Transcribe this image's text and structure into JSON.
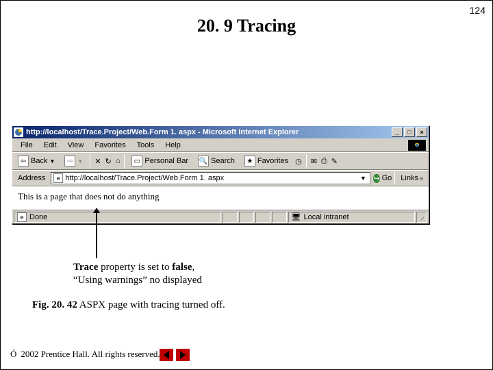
{
  "page_number": "124",
  "heading": "20. 9  Tracing",
  "browser": {
    "title": "http://localhost/Trace.Project/Web.Form 1. aspx - Microsoft Internet Explorer",
    "menus": {
      "file": "File",
      "edit": "Edit",
      "view": "View",
      "favorites": "Favorites",
      "tools": "Tools",
      "help": "Help"
    },
    "toolbar": {
      "back": "Back",
      "personal_bar": "Personal Bar",
      "search": "Search",
      "favorites": "Favorites"
    },
    "address_label": "Address",
    "url": "http://localhost/Trace.Project/Web.Form 1. aspx",
    "go": "Go",
    "links": "Links",
    "page_text": "This is a page that does not do anything",
    "status_done": "Done",
    "zone": "Local intranet"
  },
  "annotation": {
    "line1_prefix_bold": "Trace",
    "line1_rest": " property is set to ",
    "line1_bold2": "false",
    "line1_tail": ",",
    "line2": "“Using warnings” no displayed"
  },
  "figure": {
    "label_bold": "Fig. 20. 42",
    "caption": "  ASPX page with tracing turned off."
  },
  "footer": {
    "copyright_symbol": "Ó",
    "text": " 2002 Prentice Hall.  All rights reserved."
  }
}
